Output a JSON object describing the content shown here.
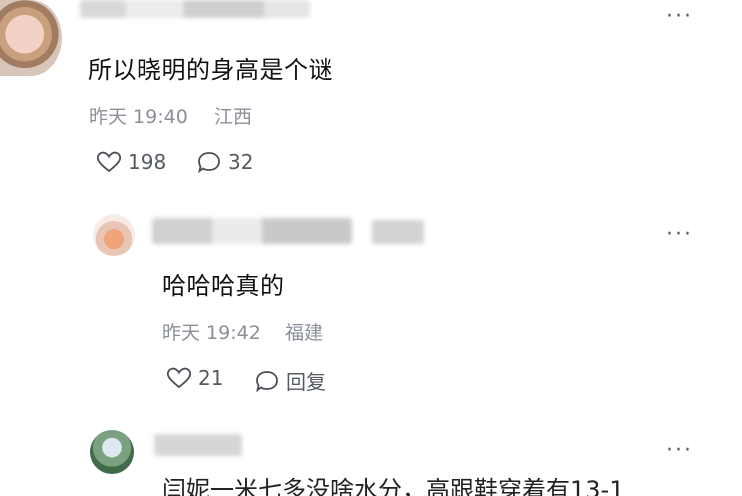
{
  "comments": [
    {
      "text": "所以晓明的身高是个谜",
      "time": "昨天 19:40",
      "location": "江西",
      "likes": "198",
      "replies": "32"
    },
    {
      "text": "哈哈哈真的",
      "time": "昨天 19:42",
      "location": "福建",
      "likes": "21",
      "reply_label": "回复"
    },
    {
      "text": "闫妮一米七多没啥水分，高跟鞋穿着有13-1"
    }
  ],
  "more_label": "···"
}
